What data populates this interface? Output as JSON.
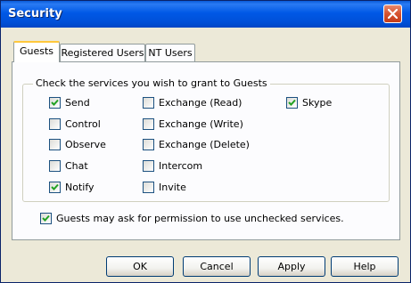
{
  "window": {
    "title": "Security"
  },
  "tabs": [
    {
      "label": "Guests",
      "active": true
    },
    {
      "label": "Registered Users",
      "active": false
    },
    {
      "label": "NT Users",
      "active": false
    }
  ],
  "group": {
    "legend": "Check the services you wish to grant to Guests"
  },
  "services": [
    {
      "label": "Send",
      "checked": true
    },
    {
      "label": "Control",
      "checked": false
    },
    {
      "label": "Observe",
      "checked": false
    },
    {
      "label": "Chat",
      "checked": false
    },
    {
      "label": "Notify",
      "checked": true
    },
    {
      "label": "Exchange (Read)",
      "checked": false
    },
    {
      "label": "Exchange (Write)",
      "checked": false
    },
    {
      "label": "Exchange (Delete)",
      "checked": false
    },
    {
      "label": "Intercom",
      "checked": false
    },
    {
      "label": "Invite",
      "checked": false
    },
    {
      "label": "Skype",
      "checked": true
    }
  ],
  "permission": {
    "label": "Guests may ask for permission to use unchecked services.",
    "checked": true
  },
  "buttons": {
    "ok": "OK",
    "cancel": "Cancel",
    "apply": "Apply",
    "help": "Help"
  }
}
